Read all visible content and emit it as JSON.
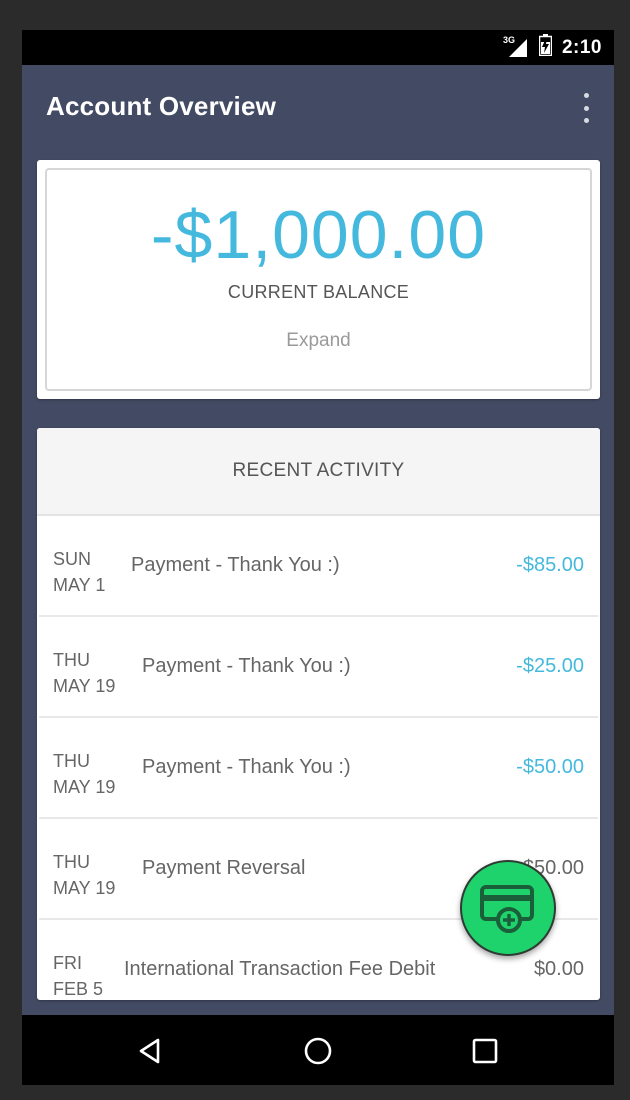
{
  "status_bar": {
    "network": "3G",
    "time": "2:10"
  },
  "app_bar": {
    "title": "Account Overview",
    "menu_icon": "more-vert-icon"
  },
  "balance": {
    "amount": "-$1,000.00",
    "label": "CURRENT BALANCE",
    "expand_label": "Expand"
  },
  "activity": {
    "header": "RECENT ACTIVITY",
    "items": [
      {
        "day": "SUN",
        "date": "MAY 1",
        "description": "Payment - Thank You :)",
        "amount": "-$85.00",
        "style": "blue"
      },
      {
        "day": "THU",
        "date": "MAY 19",
        "description": "Payment - Thank You :)",
        "amount": "-$25.00",
        "style": "blue"
      },
      {
        "day": "THU",
        "date": "MAY 19",
        "description": "Payment - Thank You :)",
        "amount": "-$50.00",
        "style": "blue"
      },
      {
        "day": "THU",
        "date": "MAY 19",
        "description": "Payment Reversal",
        "amount": "$50.00",
        "style": "gray"
      },
      {
        "day": "FRI",
        "date": "FEB 5",
        "description": "International Transaction Fee Debit",
        "amount": "$0.00",
        "style": "gray"
      }
    ]
  },
  "fab": {
    "icon": "add-card-icon"
  },
  "nav": {
    "back_icon": "back-triangle-icon",
    "home_icon": "home-circle-icon",
    "recents_icon": "recents-square-icon"
  },
  "colors": {
    "app_bar": "#434a63",
    "accent_blue": "#45b9dd",
    "fab_green": "#1ed36b"
  }
}
